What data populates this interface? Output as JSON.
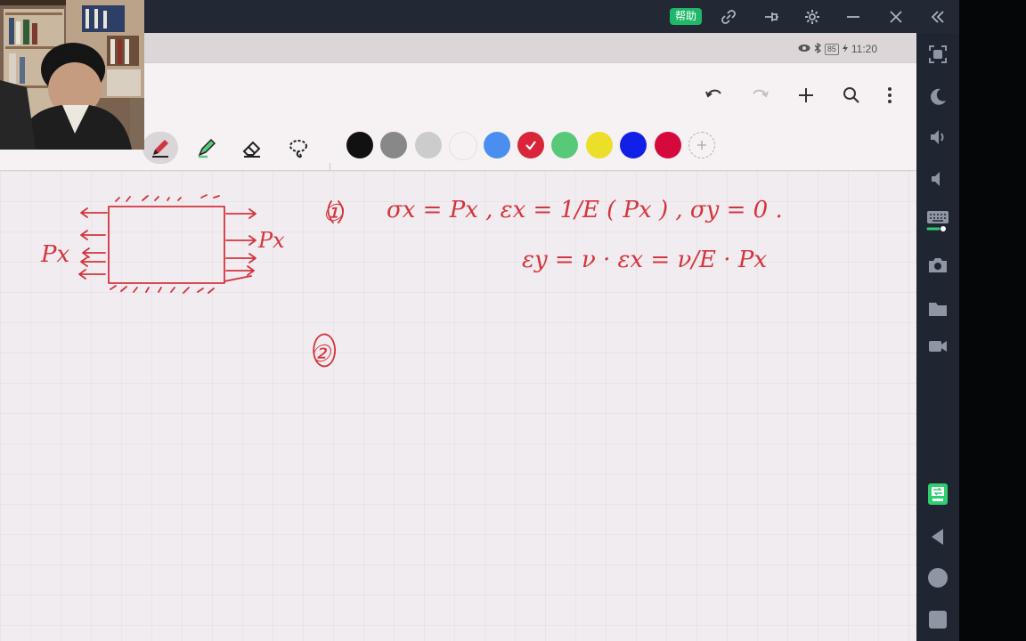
{
  "titlebar": {
    "help_label": "帮助",
    "buttons": [
      "link-icon",
      "pin-icon",
      "gear-icon",
      "minimize-icon",
      "close-icon",
      "collapse-icon"
    ]
  },
  "status": {
    "battery": "85",
    "time": "11:20"
  },
  "toolbar": {
    "actions": [
      "undo-icon",
      "redo-icon",
      "add-icon",
      "search-icon",
      "more-icon"
    ],
    "tools": [
      "pen",
      "highlighter",
      "eraser",
      "lasso"
    ],
    "active_tool": "pen",
    "colors": [
      "#111111",
      "#888888",
      "#cccccc",
      "#f6f2f4",
      "#4a8ff0",
      "#d8253a",
      "#58c879",
      "#ecdf2a",
      "#1120e6",
      "#d6093d"
    ],
    "selected_color_index": 5
  },
  "sidebar": {
    "buttons": [
      "fullscreen-icon",
      "night-mode-icon",
      "volume-up-icon",
      "volume-down-icon",
      "keyboard-icon",
      "camera-icon",
      "folder-icon",
      "video-icon",
      "share-icon",
      "back-icon",
      "home-icon",
      "recent-apps-icon"
    ]
  },
  "ink": {
    "color": "#d4343e",
    "left_force_label": "Px",
    "right_force_label": "Px",
    "step1_number": "①",
    "step1_line1": "σx = Px ,  εx = 1/E ( Px ) ,  σy = 0 .",
    "step1_line2": "εy = ν · εx = ν/E · Px",
    "step2_number": "②"
  }
}
